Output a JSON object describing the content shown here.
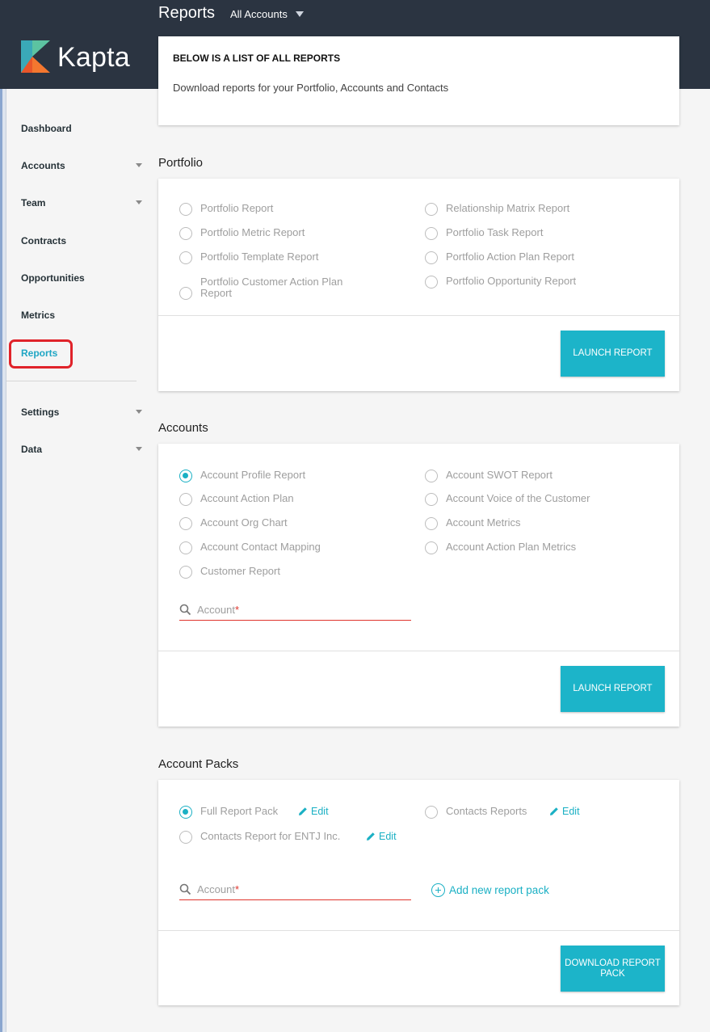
{
  "header": {
    "page_title": "Reports",
    "account_filter": "All Accounts",
    "logo_text": "Kapta"
  },
  "sidebar": {
    "items": [
      {
        "label": "Dashboard"
      },
      {
        "label": "Accounts"
      },
      {
        "label": "Team"
      },
      {
        "label": "Contracts"
      },
      {
        "label": "Opportunities"
      },
      {
        "label": "Metrics"
      },
      {
        "label": "Reports"
      },
      {
        "label": "Settings"
      },
      {
        "label": "Data"
      }
    ]
  },
  "intro": {
    "title": "BELOW IS A LIST OF ALL REPORTS",
    "description": "Download reports for your Portfolio, Accounts and Contacts"
  },
  "portfolio": {
    "title": "Portfolio",
    "options": [
      "Portfolio Report",
      "Portfolio Metric Report",
      "Portfolio Template Report",
      "Portfolio Customer Action Plan Report",
      "Relationship Matrix Report",
      "Portfolio Task Report",
      "Portfolio Action Plan Report",
      "Portfolio Opportunity Report"
    ],
    "button": "LAUNCH REPORT"
  },
  "accounts": {
    "title": "Accounts",
    "options": [
      "Account Profile Report",
      "Account Action Plan",
      "Account Org Chart",
      "Account Contact Mapping",
      "Customer Report",
      "Account SWOT Report",
      "Account Voice of the Customer",
      "Account Metrics",
      "Account Action Plan Metrics"
    ],
    "selected": "Account Profile Report",
    "search_placeholder": "Account",
    "required_mark": "*",
    "button": "LAUNCH REPORT"
  },
  "packs": {
    "title": "Account Packs",
    "options": [
      "Full Report Pack",
      "Contacts Reports",
      "Contacts Report for ENTJ Inc."
    ],
    "selected": "Full Report Pack",
    "edit_label": "Edit",
    "search_placeholder": "Account",
    "required_mark": "*",
    "add_label": "Add new report pack",
    "button": "DOWNLOAD REPORT PACK"
  },
  "colors": {
    "accent": "#1cb4c9",
    "header_bg": "#2b3441",
    "required": "#e0342c",
    "highlight": "#e0232a"
  }
}
